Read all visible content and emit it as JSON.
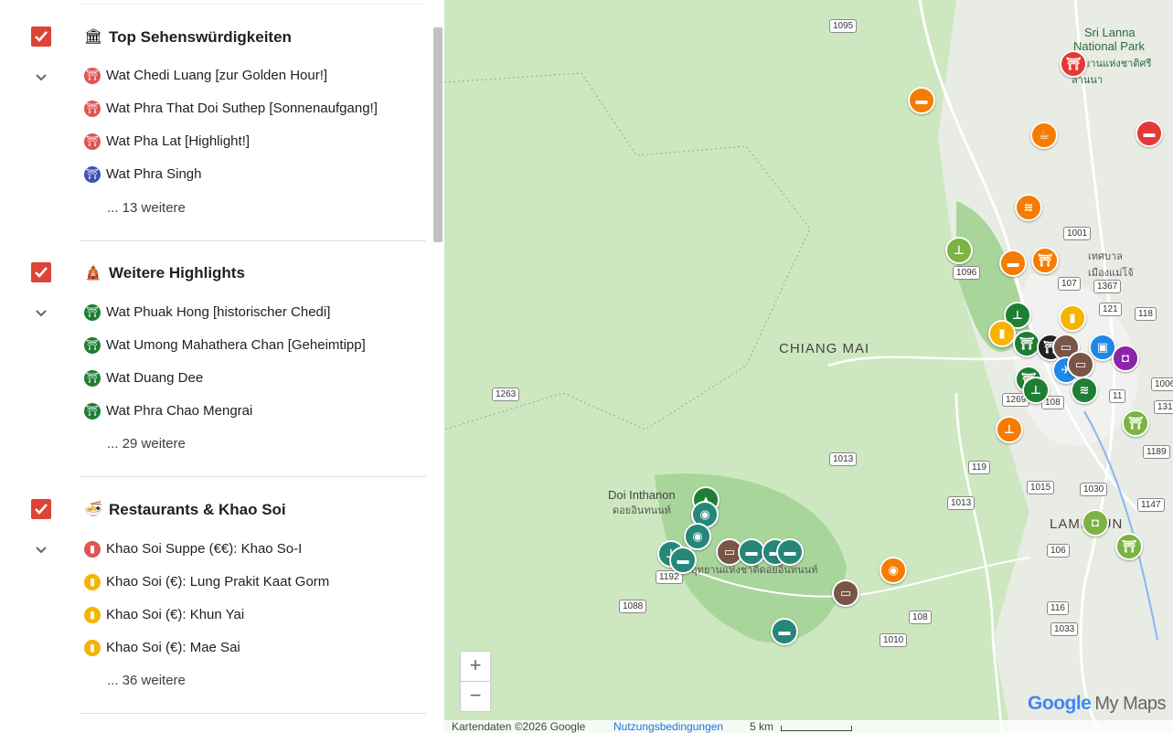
{
  "sections": [
    {
      "title": "Top Sehenswürdigkeiten",
      "icon": "🏛",
      "items": [
        {
          "label": "Wat Chedi Luang [zur Golden Hour!]",
          "color": "#e05454"
        },
        {
          "label": "Wat Phra That Doi Suthep [Sonnenaufgang!]",
          "color": "#e05454"
        },
        {
          "label": "Wat Pha Lat [Highlight!]",
          "color": "#e05454"
        },
        {
          "label": "Wat Phra Singh",
          "color": "#3f51b5"
        }
      ],
      "more": "... 13 weitere"
    },
    {
      "title": "Weitere Highlights",
      "icon": "🛕",
      "items": [
        {
          "label": "Wat Phuak Hong [historischer Chedi]",
          "color": "#1e7e34"
        },
        {
          "label": "Wat Umong Mahathera Chan [Geheimtipp]",
          "color": "#1e7e34"
        },
        {
          "label": "Wat Duang Dee",
          "color": "#1e7e34"
        },
        {
          "label": "Wat Phra Chao Mengrai",
          "color": "#1e7e34"
        }
      ],
      "more": "... 29 weitere"
    },
    {
      "title": "Restaurants & Khao Soi",
      "icon": "🍜",
      "items": [
        {
          "label": "Khao Soi Suppe (€€): Khao So-I",
          "color": "#e05454"
        },
        {
          "label": "Khao Soi (€): Lung Prakit Kaat Gorm",
          "color": "#f4b400"
        },
        {
          "label": "Khao Soi (€): Khun Yai",
          "color": "#f4b400"
        },
        {
          "label": "Khao Soi (€): Mae Sai",
          "color": "#f4b400"
        }
      ],
      "more": "... 36 weitere"
    }
  ],
  "map": {
    "places": {
      "chiang_mai": "CHIANG MAI",
      "doi_inthanon": "Doi Inthanon",
      "doi_inthanon_thai": "ดอยอินทนนท์",
      "park_thai": "อุทยานแห่งชาติดอยอินทนนท์",
      "lamphun": "LAMPHUN",
      "sri_lanna": "Sri Lanna",
      "national_park": "National Park",
      "sri_lanna_thai": "อุทยานแห่งชาติศรีลานนา",
      "mae_jo_thai": "เทศบาล เมืองแม่โจ้"
    },
    "roads": [
      "1095",
      "1001",
      "107",
      "1096",
      "121",
      "1367",
      "118",
      "1263",
      "108",
      "1269",
      "11",
      "1006",
      "131",
      "1189",
      "1013",
      "119",
      "1015",
      "1030",
      "1013",
      "1147",
      "106",
      "1192",
      "1088",
      "108",
      "116",
      "1033",
      "1010"
    ],
    "zoom_in": "+",
    "zoom_out": "−",
    "logo_brand": "Google",
    "logo_product": "My Maps",
    "attribution": "Kartendaten ©2026 Google",
    "terms": "Nutzungsbedingungen",
    "scale": "5 km"
  }
}
